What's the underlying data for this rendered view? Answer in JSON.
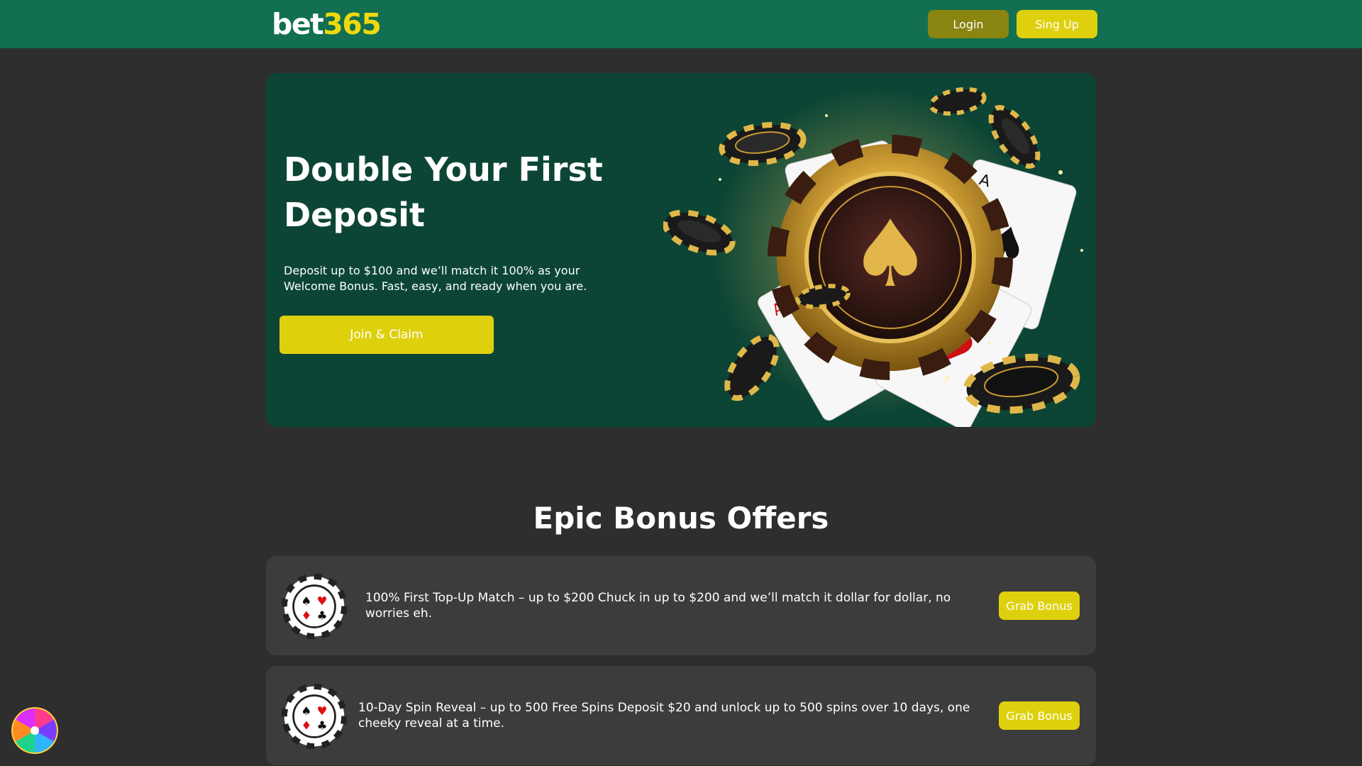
{
  "header": {
    "logo_part1": "bet",
    "logo_part2": "365",
    "login_label": "Login",
    "signup_label": "Sing Up"
  },
  "hero": {
    "title": "Double Your First Deposit",
    "description": "Deposit up to $100 and we’ll match it 100% as your Welcome Bonus. Fast, easy, and ready when you are.",
    "cta_label": "Join & Claim"
  },
  "offers_section": {
    "title": "Epic Bonus Offers",
    "offers": [
      {
        "text": "100% First Top-Up Match – up to $200 Chuck in up to $200 and we’ll match it dollar for dollar, no worries eh.",
        "button_label": "Grab Bonus",
        "icon": "poker-chip-icon"
      },
      {
        "text": "10-Day Spin Reveal – up to 500 Free Spins Deposit $20 and unlock up to 500 spins over 10 days, one cheeky reveal at a time.",
        "button_label": "Grab Bonus",
        "icon": "poker-chip-icon"
      }
    ]
  },
  "widgets": {
    "wheel_icon": "prize-wheel-icon"
  },
  "colors": {
    "header_bg": "#126f51",
    "page_bg": "#2e2e2e",
    "hero_bg": "#0c4535",
    "accent_yellow": "#dfd00e",
    "login_bg": "#8a8410",
    "card_bg": "#3c3c3c"
  }
}
